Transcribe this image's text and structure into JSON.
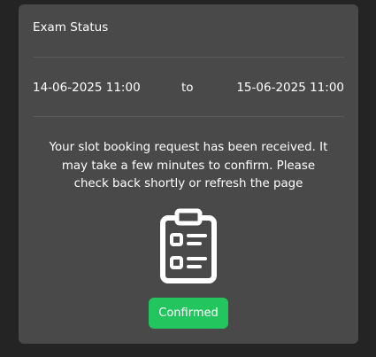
{
  "card": {
    "title": "Exam Status"
  },
  "schedule": {
    "start": "14-06-2025 11:00",
    "separator": "to",
    "end": "15-06-2025 11:00"
  },
  "message": "Your slot booking request has been received. It may take a few minutes to confirm. Please check back shortly or refresh the page",
  "icon": "clipboard-checklist-icon",
  "status_button": {
    "label": "Confirmed",
    "color": "#22c55e"
  },
  "colors": {
    "page_background": "#242424",
    "card_background": "#494949"
  }
}
